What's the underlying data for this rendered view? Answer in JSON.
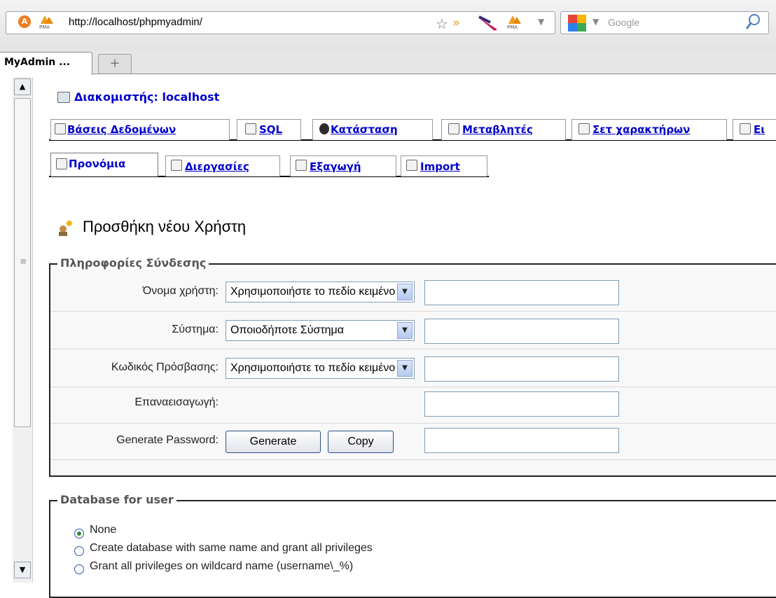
{
  "browser": {
    "url": "http://localhost/phpmyadmin/",
    "search_placeholder": "Google",
    "tab_title": "MyAdmin ...",
    "new_tab_symbol": "+"
  },
  "server": {
    "title": "Διακομιστής: localhost"
  },
  "nav_tabs": {
    "row1": [
      "Βάσεις Δεδομένων",
      "SQL",
      "Κατάσταση",
      "Μεταβλητές",
      "Σετ χαρακτήρων",
      "Ει"
    ],
    "row2": [
      "Προνόμια",
      "Διεργασίες",
      "Εξαγωγή",
      "Import"
    ]
  },
  "page": {
    "heading": "Προσθήκη νέου Χρήστη"
  },
  "login_info": {
    "legend": "Πληροφορίες Σύνδεσης",
    "username_label": "Όνομα χρήστη:",
    "username_select": "Χρησιμοποιήστε το πεδίο κειμένου",
    "host_label": "Σύστημα:",
    "host_select": "Οποιοδήποτε Σύστημα",
    "password_label": "Κωδικός Πρόσβασης:",
    "password_select": "Χρησιμοποιήστε το πεδίο κειμένου",
    "retype_label": "Επαναεισαγωγή:",
    "generate_label": "Generate Password:",
    "generate_button": "Generate",
    "copy_button": "Copy"
  },
  "database_for_user": {
    "legend": "Database for user",
    "options": [
      {
        "label": "None",
        "selected": true
      },
      {
        "label": "Create database with same name and grant all privileges",
        "selected": false
      },
      {
        "label": "Grant all privileges on wildcard name (username\\_%)",
        "selected": false
      }
    ]
  },
  "colors": {
    "link": "#0000cc",
    "radio_selected": "#2e8b3a"
  }
}
